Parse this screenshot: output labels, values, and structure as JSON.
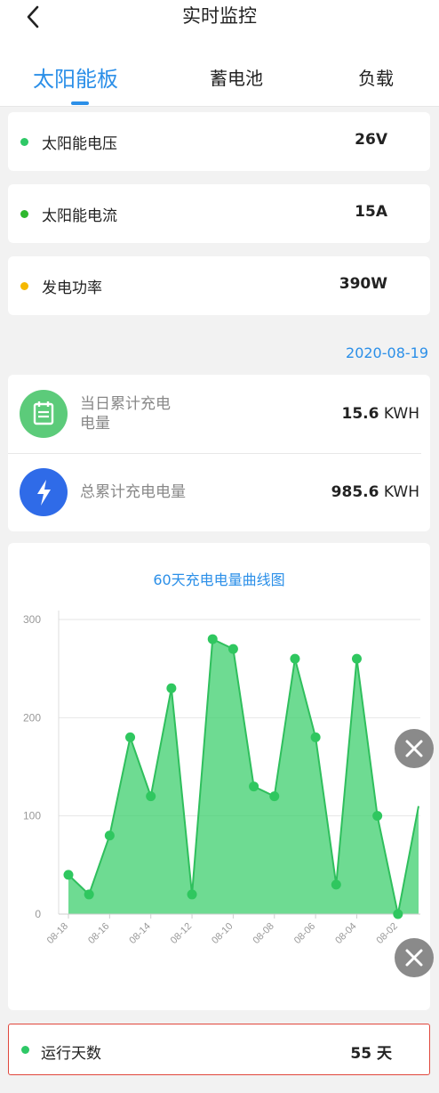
{
  "header": {
    "title": "实时监控",
    "back_icon": "chevron-left-icon"
  },
  "tabs": [
    {
      "label": "太阳能板",
      "active": true
    },
    {
      "label": "蓄电池",
      "active": false
    },
    {
      "label": "负载",
      "active": false
    }
  ],
  "metrics": [
    {
      "label": "太阳能电压",
      "value": "26V",
      "dot_color": "#2ec866"
    },
    {
      "label": "太阳能电流",
      "value": "15A",
      "dot_color": "#2eb82e"
    },
    {
      "label": "发电功率",
      "value": "390W",
      "dot_color": "#f5b800"
    }
  ],
  "date": "2020-08-19",
  "stats": {
    "daily": {
      "label_line1": "当日累计充电",
      "label_line2": "电量",
      "value": "15.6",
      "unit": "KWH",
      "icon": "battery-calendar-icon",
      "color": "#5ccb7a"
    },
    "total": {
      "label": "总累计充电电量",
      "value": "985.6",
      "unit": "KWH",
      "icon": "lightning-icon",
      "color": "#2f6be8"
    }
  },
  "chart_data": {
    "type": "area",
    "title": "60天充电电量曲线图",
    "x": [
      "08-18",
      "08-17",
      "08-16",
      "08-15",
      "08-14",
      "08-13",
      "08-12",
      "08-11",
      "08-10",
      "08-09",
      "08-08",
      "08-07",
      "08-06",
      "08-05",
      "08-04",
      "08-03",
      "08-02",
      "08-01"
    ],
    "x_tick_labels": [
      "08-18",
      "08-16",
      "08-14",
      "08-12",
      "08-10",
      "08-08",
      "08-06",
      "08-04",
      "08-02"
    ],
    "values": [
      40,
      20,
      80,
      180,
      120,
      230,
      20,
      280,
      270,
      130,
      120,
      260,
      180,
      30,
      260,
      100,
      0,
      110
    ],
    "ylim": [
      0,
      300
    ],
    "yticks": [
      0,
      100,
      200,
      300
    ],
    "grid": true,
    "color": "#3ecf6e"
  },
  "fab_icon": "close-icon",
  "run_days": {
    "label": "运行天数",
    "value": "55 天",
    "dot_color": "#2ec866"
  }
}
